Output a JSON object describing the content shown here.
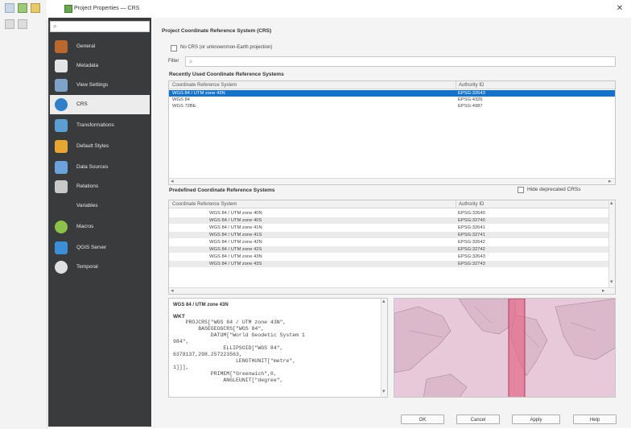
{
  "window": {
    "title": "Project Properties — CRS",
    "close_glyph": "✕"
  },
  "sidebar": {
    "search_placeholder": "",
    "search_glyph": "⌕",
    "items": [
      {
        "label": "General",
        "icon": "wrench-icon",
        "color": "#b9692e"
      },
      {
        "label": "Metadata",
        "icon": "pencil-icon",
        "color": "#e4e4e4"
      },
      {
        "label": "View Settings",
        "icon": "view-icon",
        "color": "#7fa3c8"
      },
      {
        "label": "CRS",
        "icon": "globe-icon",
        "color": "#2f80c9"
      },
      {
        "label": "Transformations",
        "icon": "transform-icon",
        "color": "#5a9fd4"
      },
      {
        "label": "Default Styles",
        "icon": "styles-icon",
        "color": "#e7a531"
      },
      {
        "label": "Data Sources",
        "icon": "datasource-icon",
        "color": "#6ba4dc"
      },
      {
        "label": "Relations",
        "icon": "relations-icon",
        "color": "#c9c9c9"
      },
      {
        "label": "Variables",
        "icon": "variables-icon",
        "color": "#3a3b3d"
      },
      {
        "label": "Macros",
        "icon": "macros-icon",
        "color": "#8bc34a"
      },
      {
        "label": "QGIS Server",
        "icon": "server-icon",
        "color": "#3b8fd6"
      },
      {
        "label": "Temporal",
        "icon": "clock-icon",
        "color": "#e0e0e0"
      }
    ],
    "selected_index": 3
  },
  "main": {
    "section_title": "Project Coordinate Reference System (CRS)",
    "no_crs_label": "No CRS (or unknown/non-Earth projection)",
    "filter_label": "Filter",
    "filter_glyph": "⌕",
    "recent_title": "Recently Used Coordinate Reference Systems",
    "col_crs": "Coordinate Reference System",
    "col_authority": "Authority ID",
    "recent_rows": [
      {
        "crs": "WGS 84 / UTM zone 43N",
        "id": "EPSG:32643",
        "selected": true
      },
      {
        "crs": "WGS 84",
        "id": "EPSG:4326",
        "selected": false
      },
      {
        "crs": "WGS 72BE",
        "id": "EPSG:4987",
        "selected": false
      }
    ],
    "predefined_title": "Predefined Coordinate Reference Systems",
    "hide_deprecated_label": "Hide deprecated CRSs",
    "predefined_rows": [
      {
        "crs": "WGS 84 / UTM zone 40N",
        "id": "EPSG:32640"
      },
      {
        "crs": "WGS 84 / UTM zone 40S",
        "id": "EPSG:32740"
      },
      {
        "crs": "WGS 84 / UTM zone 41N",
        "id": "EPSG:32641"
      },
      {
        "crs": "WGS 84 / UTM zone 41S",
        "id": "EPSG:32741"
      },
      {
        "crs": "WGS 84 / UTM zone 42N",
        "id": "EPSG:32642"
      },
      {
        "crs": "WGS 84 / UTM zone 42S",
        "id": "EPSG:32742"
      },
      {
        "crs": "WGS 84 / UTM zone 43N",
        "id": "EPSG:32643"
      },
      {
        "crs": "WGS 84 / UTM zone 43S",
        "id": "EPSG:32743"
      }
    ],
    "scroll_left": "◂",
    "scroll_right": "▸",
    "scroll_up": "▴",
    "scroll_down": "▾"
  },
  "details": {
    "crs_name": "WGS 84 / UTM zone 43N",
    "wkt_label": "WKT",
    "wkt_text": "    PROJCRS[\"WGS 84 / UTM zone 43N\",\n        BASEGEOGCRS[\"WGS 84\",\n            DATUM[\"World Geodetic System 1\n984\",\n                ELLIPSOID[\"WGS 84\",\n6378137,298.257223563,\n                    LENGTHUNIT[\"metre\",\n1]]],\n            PRIMEM[\"Greenwich\",0,\n                ANGLEUNIT[\"degree\","
  },
  "buttons": {
    "ok": "OK",
    "cancel": "Cancel",
    "apply": "Apply",
    "help": "Help"
  },
  "colors": {
    "selection": "#1473c8",
    "sidebar_bg": "#3a3b3d",
    "map_bg": "#e7c9d9",
    "map_zone": "#e26a8a"
  }
}
